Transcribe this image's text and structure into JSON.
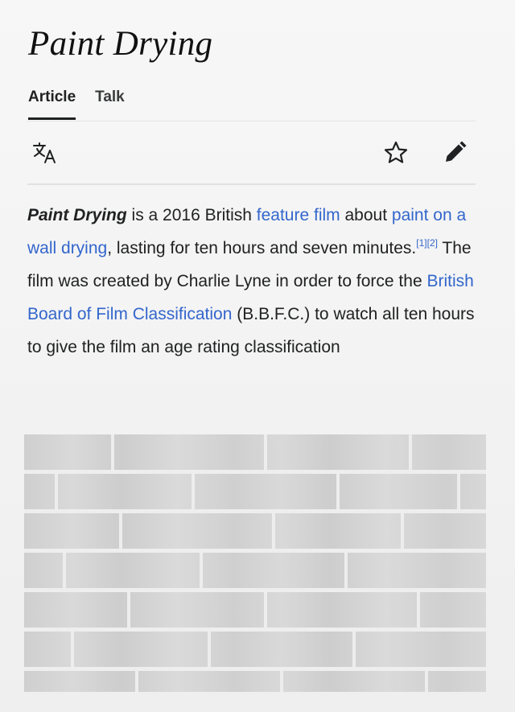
{
  "article": {
    "title": "Paint Drying"
  },
  "tabs": [
    {
      "label": "Article",
      "active": true
    },
    {
      "label": "Talk",
      "active": false
    }
  ],
  "toolbar": {
    "icons": [
      "translate-icon",
      "star-icon",
      "edit-icon"
    ]
  },
  "lead": {
    "title_bold": "Paint Drying",
    "t1": " is a 2016 British ",
    "link_feature_film": "feature film",
    "t2": " about ",
    "link_paint": "paint on a wall drying",
    "t3": ", lasting for ten hours and seven minutes.",
    "ref1": "[1]",
    "ref2": "[2]",
    "t4": " The film was created by Charlie Lyne in order to force the ",
    "link_bbfc": "British Board of Film Classification",
    "t5": " (B.B.F.C.) to watch all ten hours to give the film an age rating classification"
  },
  "colors": {
    "link": "#3366cc",
    "text": "#202122",
    "background": "#f3f3f3"
  }
}
